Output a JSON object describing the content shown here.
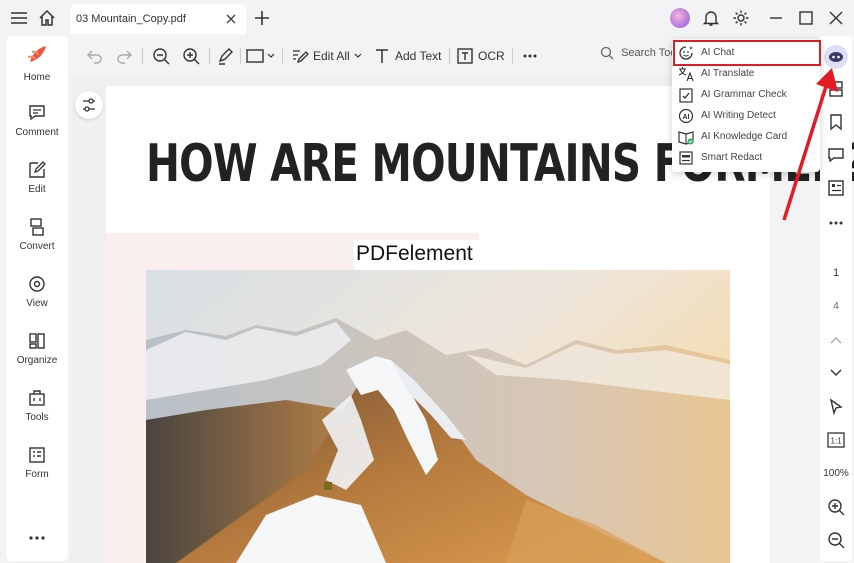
{
  "tab": {
    "title": "03 Mountain_Copy.pdf"
  },
  "sidebar": {
    "items": [
      {
        "label": "Home"
      },
      {
        "label": "Comment"
      },
      {
        "label": "Edit"
      },
      {
        "label": "Convert"
      },
      {
        "label": "View"
      },
      {
        "label": "Organize"
      },
      {
        "label": "Tools"
      },
      {
        "label": "Form"
      }
    ]
  },
  "toolbar": {
    "edit_all": "Edit All",
    "add_text": "Add Text",
    "ocr": "OCR",
    "search_placeholder": "Search Tool"
  },
  "ai_menu": {
    "items": [
      {
        "label": "AI Chat"
      },
      {
        "label": "AI Translate"
      },
      {
        "label": "AI Grammar Check"
      },
      {
        "label": "AI Writing Detect"
      },
      {
        "label": "AI Knowledge Card"
      },
      {
        "label": "Smart Redact"
      }
    ]
  },
  "document": {
    "heading": "HOW ARE MOUNTAINS FORMED?",
    "watermark": "PDFelement"
  },
  "pages": {
    "current": "1",
    "total": "4"
  },
  "zoom": {
    "level": "100%",
    "fit_label": "1:1"
  },
  "colors": {
    "accent": "#e31b23",
    "brand": "#7b61ff"
  }
}
